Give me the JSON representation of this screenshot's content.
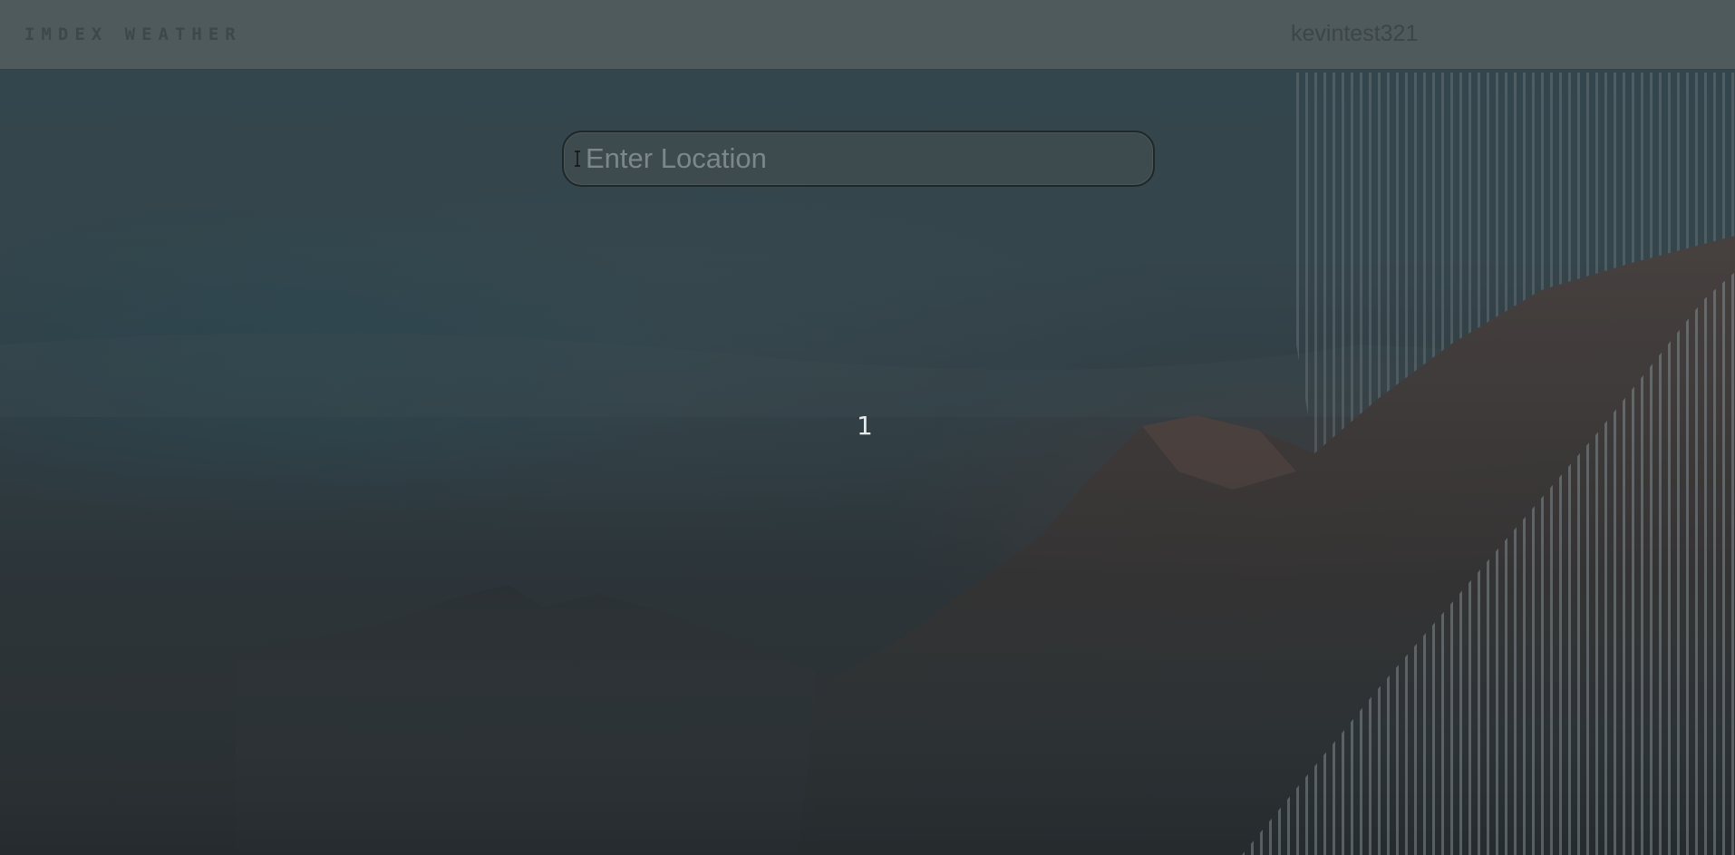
{
  "header": {
    "brand": "IMDEX WEATHER",
    "username": "kevintest321"
  },
  "search": {
    "placeholder": "Enter Location",
    "value": ""
  },
  "main": {
    "page_number": "1"
  },
  "colors": {
    "header_bg": "#5a6264",
    "brand_text": "#3e474a",
    "page_number": "#e6ebec"
  },
  "icons": {
    "cursor": "text-cursor-icon"
  }
}
